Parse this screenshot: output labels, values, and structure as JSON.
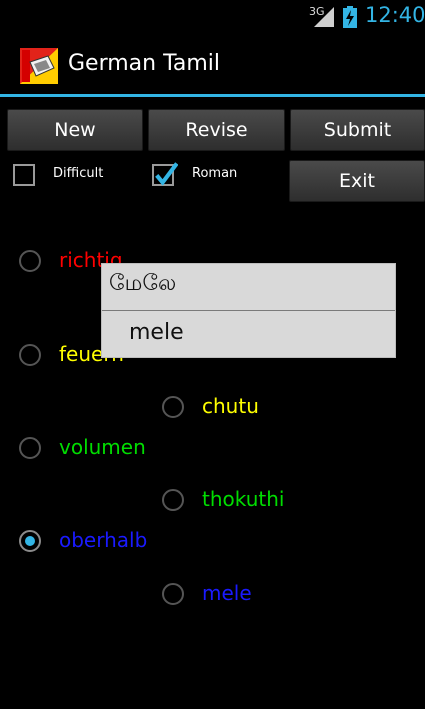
{
  "status_bar": {
    "network": "3G",
    "time": "12:40"
  },
  "action_bar": {
    "title": "German Tamil"
  },
  "buttons": {
    "new": "New",
    "revise": "Revise",
    "submit": "Submit",
    "exit": "Exit"
  },
  "checkboxes": [
    {
      "label": "Difficult",
      "checked": false
    },
    {
      "label": "Roman",
      "checked": true
    }
  ],
  "options": [
    {
      "text": "richtig",
      "color": "#ff0000",
      "selected": false
    },
    {
      "text": "feuern",
      "color": "#ffff00",
      "selected": false
    },
    {
      "text": "chutu",
      "color": "#ffff00",
      "selected": false
    },
    {
      "text": "volumen",
      "color": "#00dd00",
      "selected": false
    },
    {
      "text": "thokuthi",
      "color": "#00dd00",
      "selected": false
    },
    {
      "text": "oberhalb",
      "color": "#1a1aff",
      "selected": true
    },
    {
      "text": "mele",
      "color": "#1a1aff",
      "selected": false
    }
  ],
  "popup": {
    "tamil": "மேலே",
    "roman": "mele"
  },
  "colors": {
    "accent": "#33b5e5"
  }
}
